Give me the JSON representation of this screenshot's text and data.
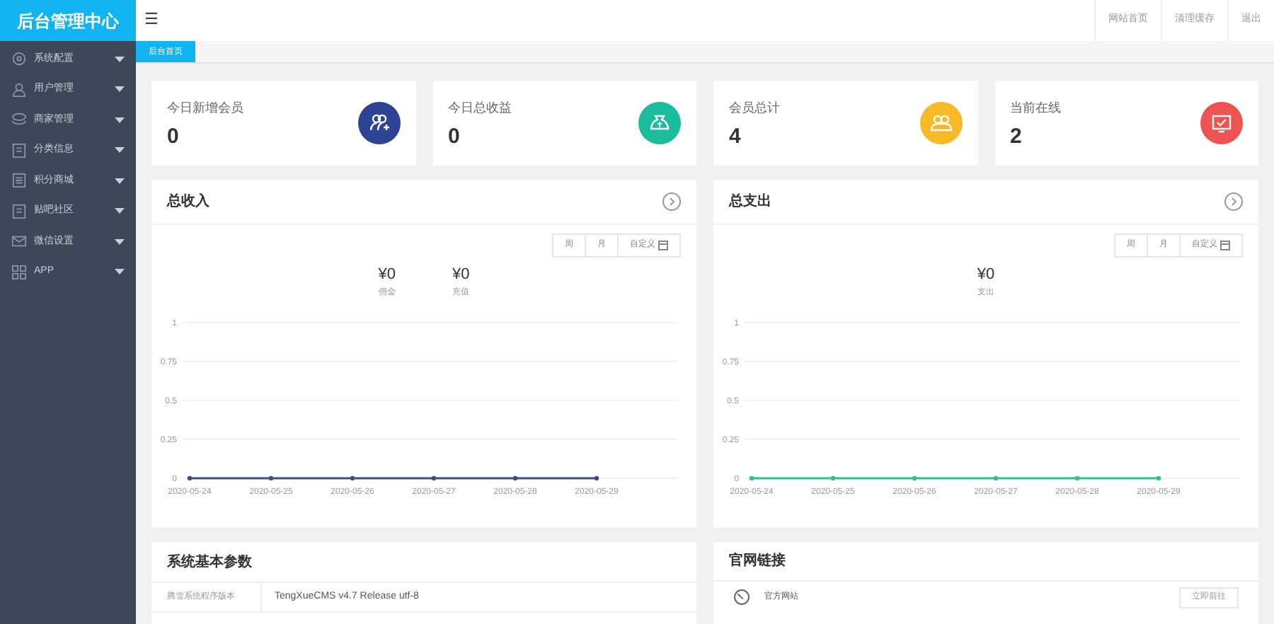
{
  "logo": "后台管理中心",
  "sidebar": {
    "items": [
      {
        "label": "系统配置"
      },
      {
        "label": "用户管理"
      },
      {
        "label": "商家管理"
      },
      {
        "label": "分类信息"
      },
      {
        "label": "积分商城"
      },
      {
        "label": "贴吧社区"
      },
      {
        "label": "微信设置"
      },
      {
        "label": "APP"
      }
    ]
  },
  "header": {
    "menu_icon": "☰",
    "links": [
      "网站首页",
      "清理缓存",
      "退出"
    ]
  },
  "tabs": [
    {
      "label": "后台首页",
      "selected": true
    }
  ],
  "stats": [
    {
      "label": "今日新增会员",
      "value": "0",
      "color": "#2f4394"
    },
    {
      "label": "今日总收益",
      "value": "0",
      "color": "#1abc9c"
    },
    {
      "label": "会员总计",
      "value": "4",
      "color": "#f7b924"
    },
    {
      "label": "当前在线",
      "value": "2",
      "color": "#ef5350"
    }
  ],
  "panels": [
    {
      "title": "总收入",
      "ranges": [
        "周",
        "月",
        "自定义"
      ],
      "totals": [
        {
          "amount": "¥0",
          "label": "佣金"
        },
        {
          "amount": "¥0",
          "label": "充值"
        }
      ],
      "chart_data": {
        "type": "line",
        "grid": true,
        "categories": [
          "2020-05-24",
          "2020-05-25",
          "2020-05-26",
          "2020-05-27",
          "2020-05-28",
          "2020-05-29"
        ],
        "yticks": [
          0,
          0.25,
          0.5,
          0.75,
          1
        ],
        "ylim": [
          0,
          1
        ],
        "series": [
          {
            "color": "#3b4e8c",
            "marker": true,
            "values": [
              0,
              0,
              0,
              0,
              0,
              0
            ]
          }
        ]
      }
    },
    {
      "title": "总支出",
      "ranges": [
        "周",
        "月",
        "自定义"
      ],
      "totals": [
        {
          "amount": "¥0",
          "label": "支出"
        }
      ],
      "chart_data": {
        "type": "line",
        "grid": true,
        "categories": [
          "2020-05-24",
          "2020-05-25",
          "2020-05-26",
          "2020-05-27",
          "2020-05-28",
          "2020-05-29"
        ],
        "yticks": [
          0,
          0.25,
          0.5,
          0.75,
          1
        ],
        "ylim": [
          0,
          1
        ],
        "series": [
          {
            "color": "#2fc095",
            "marker": true,
            "values": [
              0,
              0,
              0,
              0,
              0,
              0
            ]
          }
        ]
      }
    }
  ],
  "system_params": {
    "title": "系统基本参数",
    "rows": [
      {
        "name": "腾雪系统程序版本",
        "value": "TengXueCMS v4.7 Release utf-8"
      }
    ]
  },
  "site_links": {
    "title": "官网链接",
    "items": [
      {
        "label": "官方网站",
        "button": "立即前往"
      }
    ]
  }
}
